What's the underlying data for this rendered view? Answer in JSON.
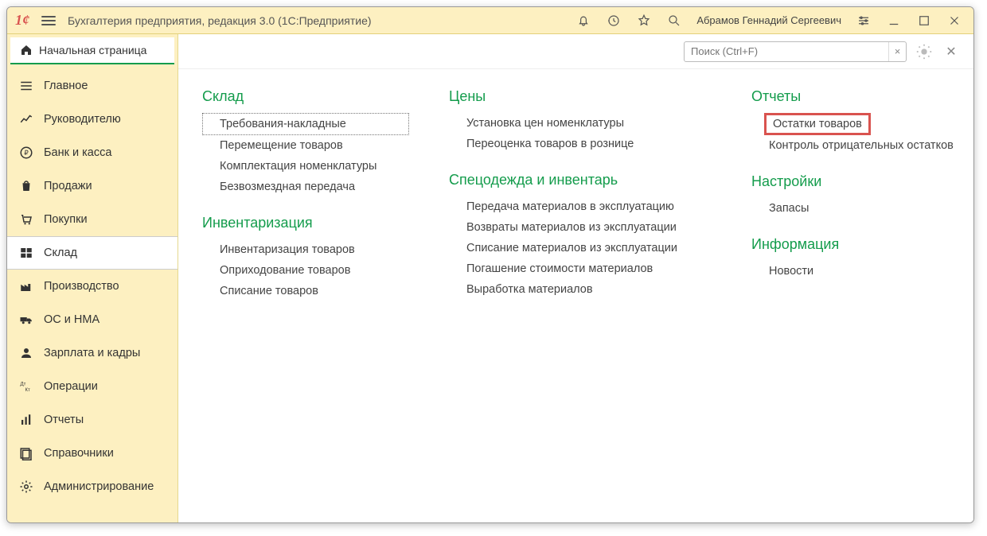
{
  "titlebar": {
    "app_title": "Бухгалтерия предприятия, редакция 3.0  (1С:Предприятие)",
    "user": "Абрамов Геннадий Сергеевич"
  },
  "sidebar": {
    "home_tab": "Начальная страница",
    "items": [
      {
        "icon": "menu",
        "label": "Главное"
      },
      {
        "icon": "trend",
        "label": "Руководителю"
      },
      {
        "icon": "ruble",
        "label": "Банк и касса"
      },
      {
        "icon": "bag",
        "label": "Продажи"
      },
      {
        "icon": "cart",
        "label": "Покупки"
      },
      {
        "icon": "boxes",
        "label": "Склад",
        "active": true
      },
      {
        "icon": "factory",
        "label": "Производство"
      },
      {
        "icon": "truck",
        "label": "ОС и НМА"
      },
      {
        "icon": "person",
        "label": "Зарплата и кадры"
      },
      {
        "icon": "dtct",
        "label": "Операции"
      },
      {
        "icon": "bars",
        "label": "Отчеты"
      },
      {
        "icon": "books",
        "label": "Справочники"
      },
      {
        "icon": "gear",
        "label": "Администрирование"
      }
    ]
  },
  "header": {
    "search_placeholder": "Поиск (Ctrl+F)",
    "clear_icon": "×"
  },
  "sections": {
    "col1": [
      {
        "title": "Склад",
        "items": [
          {
            "label": "Требования-накладные",
            "selected": true
          },
          {
            "label": "Перемещение товаров"
          },
          {
            "label": "Комплектация номенклатуры"
          },
          {
            "label": "Безвозмездная передача"
          }
        ]
      },
      {
        "title": "Инвентаризация",
        "items": [
          {
            "label": "Инвентаризация товаров"
          },
          {
            "label": "Оприходование товаров"
          },
          {
            "label": "Списание товаров"
          }
        ]
      }
    ],
    "col2": [
      {
        "title": "Цены",
        "items": [
          {
            "label": "Установка цен номенклатуры"
          },
          {
            "label": "Переоценка товаров в рознице"
          }
        ]
      },
      {
        "title": "Спецодежда и инвентарь",
        "items": [
          {
            "label": "Передача материалов в эксплуатацию"
          },
          {
            "label": "Возвраты материалов из эксплуатации"
          },
          {
            "label": "Списание материалов из эксплуатации"
          },
          {
            "label": "Погашение стоимости материалов"
          },
          {
            "label": "Выработка материалов"
          }
        ]
      }
    ],
    "col3": [
      {
        "title": "Отчеты",
        "items": [
          {
            "label": "Остатки товаров",
            "highlight": true
          },
          {
            "label": "Контроль отрицательных остатков"
          }
        ]
      },
      {
        "title": "Настройки",
        "items": [
          {
            "label": "Запасы"
          }
        ]
      },
      {
        "title": "Информация",
        "items": [
          {
            "label": "Новости"
          }
        ]
      }
    ]
  }
}
